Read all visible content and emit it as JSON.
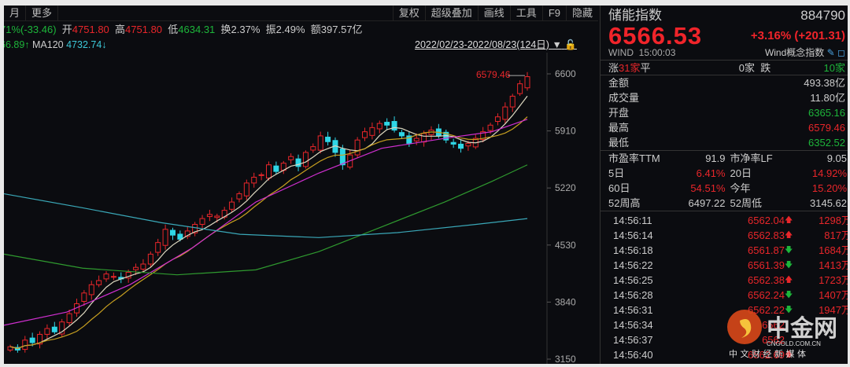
{
  "toolbar": {
    "left": [
      "月",
      "更多"
    ],
    "right": [
      "复权",
      "超级叠加",
      "画线",
      "工具",
      "F9",
      "隐藏"
    ]
  },
  "quote": {
    "change": "71%(-33.46)",
    "open_label": "开",
    "open": "4751.80",
    "high_label": "高",
    "high": "4751.80",
    "low_label": "低",
    "low": "4634.31",
    "turnover_label": "换",
    "turnover": "2.37%",
    "amp_label": "振",
    "amp": "2.49%",
    "amount_label": "额",
    "amount": "397.57亿"
  },
  "ma": {
    "prev_value": "66.89",
    "ma120_label": "MA120",
    "ma120_value": "4732.74"
  },
  "range": "2022/02/23-2022/08/23(124日)",
  "chart_data": {
    "type": "candlestick",
    "ylim": [
      3150,
      6600
    ],
    "yticks": [
      "6600",
      "5910",
      "5220",
      "4530",
      "3840",
      "3150"
    ],
    "high_annotation": "6579.46",
    "closes": [
      3300,
      3260,
      3380,
      3350,
      3450,
      3520,
      3480,
      3600,
      3700,
      3820,
      3950,
      4050,
      4100,
      4180,
      4150,
      4120,
      4200,
      4260,
      4300,
      4420,
      4560,
      4720,
      4650,
      4600,
      4700,
      4780,
      4850,
      4900,
      4880,
      4950,
      5050,
      5150,
      5280,
      5350,
      5380,
      5500,
      5420,
      5520,
      5600,
      5480,
      5650,
      5720,
      5850,
      5780,
      5650,
      5500,
      5620,
      5800,
      5900,
      5950,
      6000,
      5980,
      5920,
      5850,
      5760,
      5820,
      5880,
      5920,
      5850,
      5800,
      5750,
      5700,
      5760,
      5820,
      5900,
      5980,
      6080,
      6200,
      6330,
      6480,
      6566
    ],
    "ma_long": [
      {
        "name": "MA-magenta",
        "color": "#d02fd0",
        "points": [
          [
            0,
            3560
          ],
          [
            80,
            3720
          ],
          [
            160,
            4050
          ],
          [
            240,
            4500
          ],
          [
            320,
            5050
          ],
          [
            400,
            5400
          ],
          [
            480,
            5700
          ],
          [
            560,
            5820
          ],
          [
            620,
            5900
          ],
          [
            665,
            6050
          ]
        ]
      },
      {
        "name": "MA-green",
        "color": "#2f9a2f",
        "points": [
          [
            0,
            4420
          ],
          [
            100,
            4250
          ],
          [
            220,
            4170
          ],
          [
            320,
            4230
          ],
          [
            400,
            4450
          ],
          [
            480,
            4750
          ],
          [
            560,
            5050
          ],
          [
            620,
            5300
          ],
          [
            665,
            5500
          ]
        ]
      },
      {
        "name": "MA120",
        "color": "#3aa8b8",
        "points": [
          [
            0,
            5150
          ],
          [
            100,
            4980
          ],
          [
            200,
            4800
          ],
          [
            300,
            4660
          ],
          [
            400,
            4620
          ],
          [
            500,
            4680
          ],
          [
            600,
            4780
          ],
          [
            665,
            4850
          ]
        ]
      }
    ]
  },
  "panel": {
    "name": "储能指数",
    "code": "884790",
    "price": "6566.53",
    "change": "+3.16% (+201.31)",
    "source": "WIND",
    "time": "15:00:03",
    "index_type": "Wind概念指数",
    "breadth": {
      "up_label": "涨",
      "up": "31家",
      "flat_label": "平",
      "flat": "0家",
      "down_label": "跌",
      "down": "10家"
    },
    "stats": [
      {
        "label": "金额",
        "value": "493.38亿",
        "color": "grey"
      },
      {
        "label": "成交量",
        "value": "11.80亿",
        "color": "grey"
      },
      {
        "label": "开盘",
        "value": "6365.16",
        "color": "green"
      },
      {
        "label": "最高",
        "value": "6579.46",
        "color": "red"
      },
      {
        "label": "最低",
        "value": "6352.52",
        "color": "green"
      }
    ],
    "pairs": [
      [
        {
          "label": "市盈率TTM",
          "value": "91.9",
          "color": "grey"
        },
        {
          "label": "市净率LF",
          "value": "9.05",
          "color": "grey"
        }
      ],
      [
        {
          "label": "5日",
          "value": "6.41%",
          "color": "red"
        },
        {
          "label": "20日",
          "value": "14.92%",
          "color": "red"
        }
      ],
      [
        {
          "label": "60日",
          "value": "54.51%",
          "color": "red"
        },
        {
          "label": "今年",
          "value": "15.20%",
          "color": "red"
        }
      ],
      [
        {
          "label": "52周高",
          "value": "6497.22",
          "color": "grey"
        },
        {
          "label": "52周低",
          "value": "3145.62",
          "color": "grey"
        }
      ]
    ],
    "ticks": [
      {
        "time": "14:56:11",
        "price": "6562.04",
        "dir": "up",
        "vol": "1298万"
      },
      {
        "time": "14:56:14",
        "price": "6562.83",
        "dir": "up",
        "vol": "817万"
      },
      {
        "time": "14:56:18",
        "price": "6561.87",
        "dir": "down",
        "vol": "1684万"
      },
      {
        "time": "14:56:22",
        "price": "6561.39",
        "dir": "down",
        "vol": "1413万"
      },
      {
        "time": "14:56:25",
        "price": "6562.38",
        "dir": "up",
        "vol": "1723万"
      },
      {
        "time": "14:56:28",
        "price": "6562.24",
        "dir": "down",
        "vol": "1407万"
      },
      {
        "time": "14:56:31",
        "price": "6562.22",
        "dir": "down",
        "vol": "1947万"
      },
      {
        "time": "14:56:34",
        "price": "6562",
        "dir": "",
        "vol": ""
      },
      {
        "time": "14:56:37",
        "price": "6562",
        "dir": "",
        "vol": ""
      },
      {
        "time": "14:56:40",
        "price": "6562.69",
        "dir": "up",
        "vol": ""
      }
    ]
  },
  "watermark": {
    "name": "中金网",
    "domain": "CNGOLD.COM.CN",
    "slogan": "中 文 财 经 新 媒 体"
  }
}
